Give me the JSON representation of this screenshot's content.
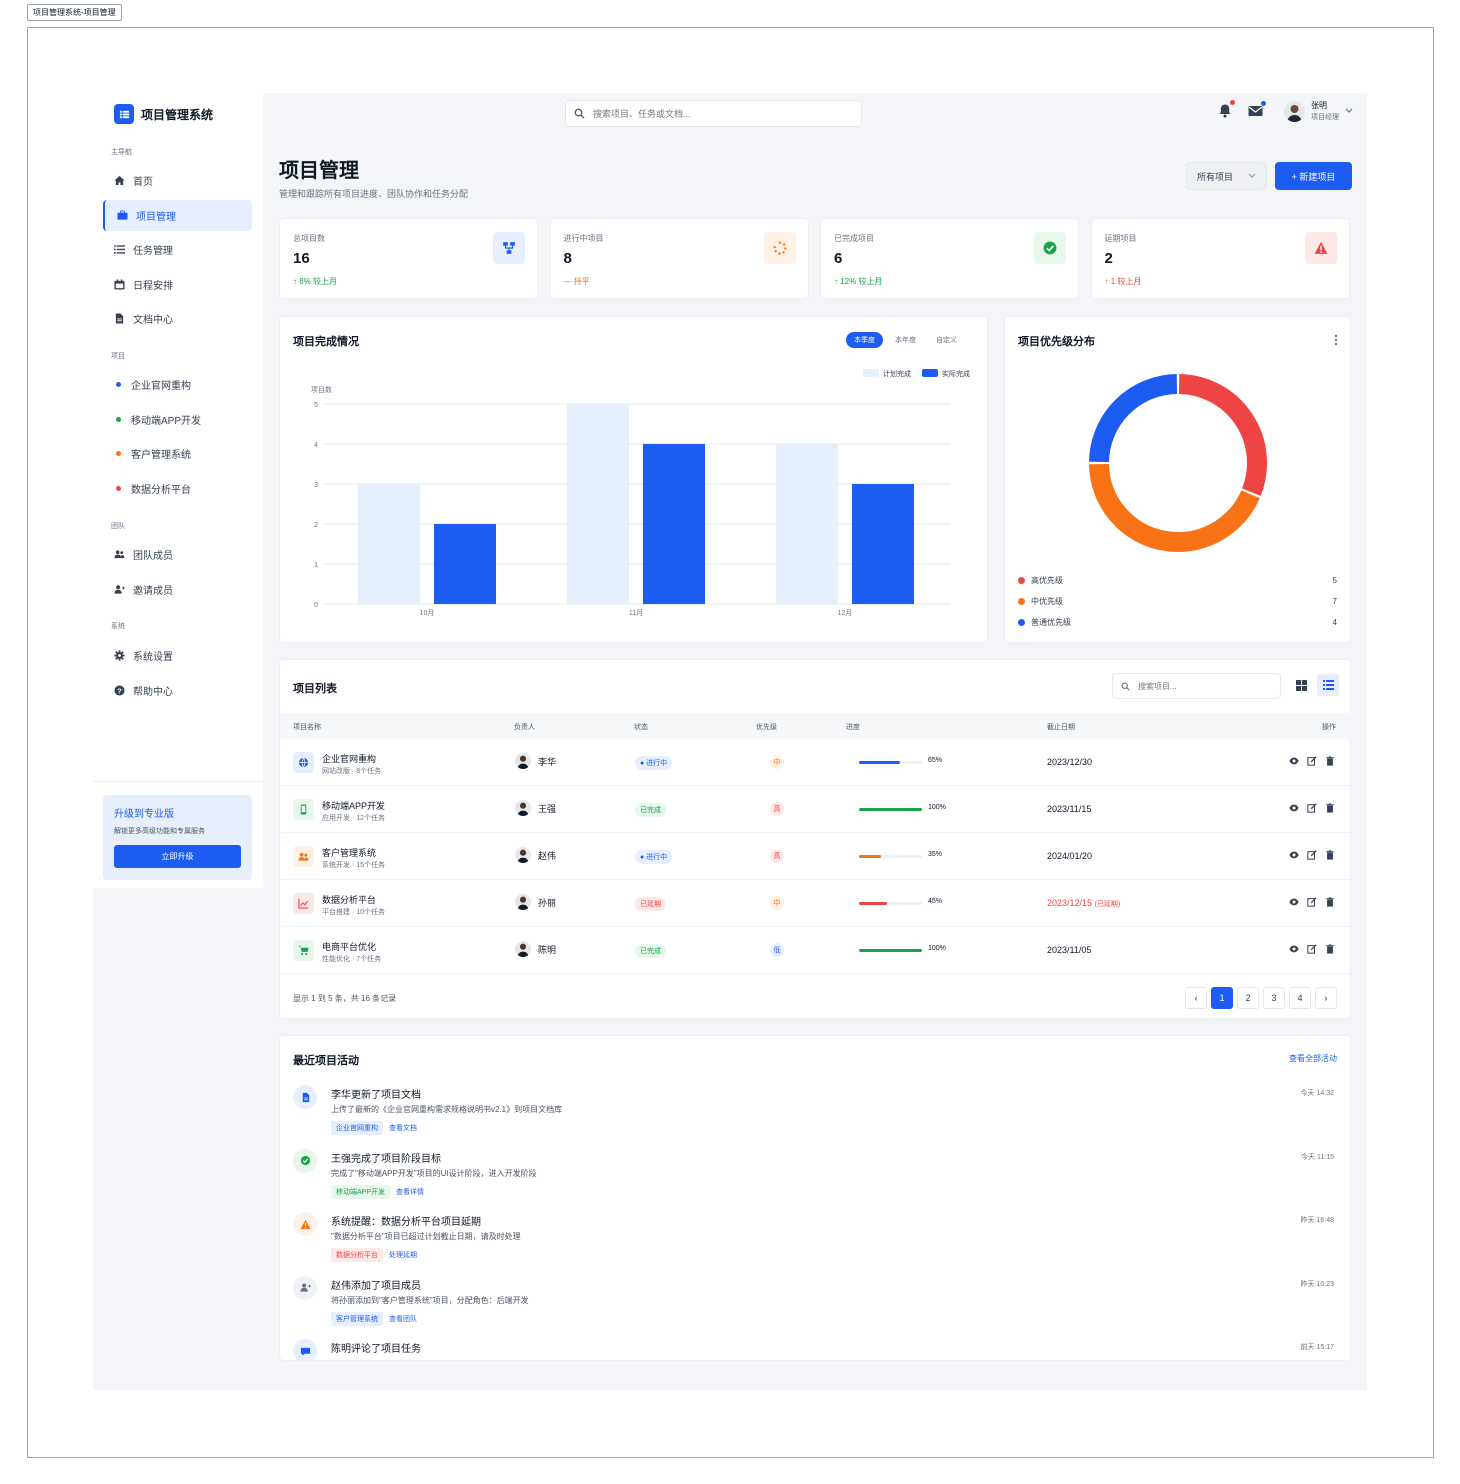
{
  "window_label": "项目管理系统-项目管理",
  "app": {
    "logo_text": "项目管理系统"
  },
  "search": {
    "placeholder": "搜索项目、任务或文档..."
  },
  "user": {
    "name": "张明",
    "role": "项目经理"
  },
  "sidebar": {
    "main_label": "主导航",
    "main_items": [
      {
        "label": "首页",
        "icon": "home-icon"
      },
      {
        "label": "项目管理",
        "icon": "briefcase-icon",
        "active": true
      },
      {
        "label": "任务管理",
        "icon": "list-icon"
      },
      {
        "label": "日程安排",
        "icon": "calendar-icon"
      },
      {
        "label": "文档中心",
        "icon": "file-icon"
      }
    ],
    "project_label": "项目",
    "projects": [
      {
        "label": "企业官网重构",
        "color": "#1d5cf0"
      },
      {
        "label": "移动端APP开发",
        "color": "#16a34a"
      },
      {
        "label": "客户管理系统",
        "color": "#f97316"
      },
      {
        "label": "数据分析平台",
        "color": "#ef4444"
      }
    ],
    "team_label": "团队",
    "team_items": [
      {
        "label": "团队成员",
        "icon": "users-icon"
      },
      {
        "label": "邀请成员",
        "icon": "user-plus-icon"
      }
    ],
    "system_label": "系统",
    "system_items": [
      {
        "label": "系统设置",
        "icon": "gear-icon"
      },
      {
        "label": "帮助中心",
        "icon": "help-icon"
      }
    ],
    "upgrade": {
      "title": "升级到专业版",
      "desc": "解锁更多高级功能和专属服务",
      "button": "立即升级"
    }
  },
  "page": {
    "title": "项目管理",
    "subtitle": "管理和跟踪所有项目进度、团队协作和任务分配",
    "filter_label": "所有项目",
    "new_button": "+ 新建项目"
  },
  "stats": [
    {
      "label": "总项目数",
      "value": "16",
      "change": "↑ 8% 较上月",
      "color": "#16a34a",
      "icon_bg": "#e6eeff",
      "icon_color": "#1d5cf0"
    },
    {
      "label": "进行中项目",
      "value": "8",
      "change": "— 持平",
      "color": "#f97316",
      "icon_bg": "#fff1e6",
      "icon_color": "#f97316"
    },
    {
      "label": "已完成项目",
      "value": "6",
      "change": "↑ 12% 较上月",
      "color": "#16a34a",
      "icon_bg": "#e7f7ec",
      "icon_color": "#16a34a"
    },
    {
      "label": "延期项目",
      "value": "2",
      "change": "↑ 1 较上月",
      "color": "#ef4444",
      "icon_bg": "#fde8e8",
      "icon_color": "#ef4444"
    }
  ],
  "completion": {
    "title": "项目完成情况",
    "tabs": [
      "本季度",
      "本年度",
      "自定义"
    ]
  },
  "chart_data": [
    {
      "type": "bar",
      "title": "项目完成情况",
      "ylabel": "项目数",
      "categories": [
        "10月",
        "11月",
        "12月"
      ],
      "ylim": [
        0,
        5
      ],
      "yticks": [
        0,
        1,
        2,
        3,
        4,
        5
      ],
      "legend_position": "top-right",
      "series": [
        {
          "name": "计划完成",
          "values": [
            3,
            5,
            4
          ],
          "color": "#e6effc"
        },
        {
          "name": "实际完成",
          "values": [
            2,
            4,
            3
          ],
          "color": "#1d5cf0"
        }
      ]
    },
    {
      "type": "pie",
      "title": "项目优先级分布",
      "labels": [
        "高优先级",
        "中优先级",
        "普通优先级"
      ],
      "values": [
        5,
        7,
        4
      ],
      "colors": [
        "#ef4444",
        "#f97316",
        "#1d5cf0"
      ]
    }
  ],
  "priority": {
    "title": "项目优先级分布",
    "items": [
      {
        "label": "高优先级",
        "value": "5",
        "color": "#ef4444"
      },
      {
        "label": "中优先级",
        "value": "7",
        "color": "#f97316"
      },
      {
        "label": "普通优先级",
        "value": "4",
        "color": "#1d5cf0"
      }
    ]
  },
  "project_list": {
    "title": "项目列表",
    "search_placeholder": "搜索项目...",
    "columns": [
      "项目名称",
      "负责人",
      "状态",
      "优先级",
      "进度",
      "截止日期",
      "操作"
    ],
    "rows": [
      {
        "name": "企业官网重构",
        "sub": "网站改版 · 8个任务",
        "owner": "李华",
        "status": "● 进行中",
        "status_fg": "#1d5cf0",
        "status_bg": "#e6eeff",
        "priority": "中",
        "prio_fg": "#f97316",
        "prio_bg": "#fff1e6",
        "progress": 65,
        "pct": "65%",
        "bar_color": "#1d5cf0",
        "due": "2023/12/30",
        "due_note": "",
        "icon": "globe-icon",
        "icon_bg": "#e6eeff",
        "icon_color": "#1d5cf0"
      },
      {
        "name": "移动端APP开发",
        "sub": "应用开发 · 12个任务",
        "owner": "王强",
        "status": "已完成",
        "status_fg": "#16a34a",
        "status_bg": "#e7f7ec",
        "priority": "高",
        "prio_fg": "#ef4444",
        "prio_bg": "#fde8e8",
        "progress": 100,
        "pct": "100%",
        "bar_color": "#16a34a",
        "due": "2023/11/15",
        "due_note": "",
        "icon": "mobile-icon",
        "icon_bg": "#e7f7ec",
        "icon_color": "#16a34a"
      },
      {
        "name": "客户管理系统",
        "sub": "系统开发 · 15个任务",
        "owner": "赵伟",
        "status": "● 进行中",
        "status_fg": "#1d5cf0",
        "status_bg": "#e6eeff",
        "priority": "高",
        "prio_fg": "#ef4444",
        "prio_bg": "#fde8e8",
        "progress": 35,
        "pct": "35%",
        "bar_color": "#f97316",
        "due": "2024/01/20",
        "due_note": "",
        "icon": "users-icon",
        "icon_bg": "#fff1e6",
        "icon_color": "#f97316"
      },
      {
        "name": "数据分析平台",
        "sub": "平台搭建 · 10个任务",
        "owner": "孙丽",
        "status": "已延期",
        "status_fg": "#ef4444",
        "status_bg": "#fde8e8",
        "priority": "中",
        "prio_fg": "#f97316",
        "prio_bg": "#fff1e6",
        "progress": 45,
        "pct": "45%",
        "bar_color": "#ef4444",
        "due": "2023/12/15",
        "due_note": "(已延期)",
        "icon": "chart-line-icon",
        "icon_bg": "#fde8e8",
        "icon_color": "#ef4444"
      },
      {
        "name": "电商平台优化",
        "sub": "性能优化 · 7个任务",
        "owner": "陈明",
        "status": "已完成",
        "status_fg": "#16a34a",
        "status_bg": "#e7f7ec",
        "priority": "低",
        "prio_fg": "#1d5cf0",
        "prio_bg": "#e6eeff",
        "progress": 100,
        "pct": "100%",
        "bar_color": "#16a34a",
        "due": "2023/11/05",
        "due_note": "",
        "icon": "cart-icon",
        "icon_bg": "#e7f7ec",
        "icon_color": "#16a34a"
      }
    ],
    "summary": "显示 1 到 5 条，共 16 条记录",
    "pages": [
      "1",
      "2",
      "3",
      "4"
    ]
  },
  "activity": {
    "title": "最近项目活动",
    "view_all": "查看全部活动",
    "items": [
      {
        "title": "李华更新了项目文档",
        "desc": "上传了最新的《企业官网重构需求规格说明书v2.1》到项目文档库",
        "tag": "企业官网重构",
        "tag_fg": "#1d5cf0",
        "tag_bg": "#e6eeff",
        "link": "查看文档",
        "time": "今天 14:32",
        "icon": "document-icon",
        "icon_bg": "#e6eeff",
        "icon_color": "#1d5cf0"
      },
      {
        "title": "王强完成了项目阶段目标",
        "desc": "完成了\"移动端APP开发\"项目的UI设计阶段，进入开发阶段",
        "tag": "移动端APP开发",
        "tag_fg": "#16a34a",
        "tag_bg": "#e7f7ec",
        "link": "查看详情",
        "time": "今天 11:15",
        "icon": "check-circle-icon",
        "icon_bg": "#e7f7ec",
        "icon_color": "#16a34a"
      },
      {
        "title": "系统提醒：数据分析平台项目延期",
        "desc": "\"数据分析平台\"项目已超过计划截止日期，请及时处理",
        "tag": "数据分析平台",
        "tag_fg": "#ef4444",
        "tag_bg": "#fde8e8",
        "link": "处理延期",
        "time": "昨天 16:48",
        "icon": "warning-icon",
        "icon_bg": "#fff1e6",
        "icon_color": "#f97316"
      },
      {
        "title": "赵伟添加了项目成员",
        "desc": "将孙丽添加到\"客户管理系统\"项目，分配角色：后端开发",
        "tag": "客户管理系统",
        "tag_fg": "#1d5cf0",
        "tag_bg": "#e6eeff",
        "link": "查看团队",
        "time": "昨天 10:23",
        "icon": "user-plus-icon",
        "icon_bg": "#f1f2f5",
        "icon_color": "#6b7280"
      },
      {
        "title": "陈明评论了项目任务",
        "desc": "",
        "tag": "",
        "tag_fg": "#1d5cf0",
        "tag_bg": "#e6eeff",
        "link": "",
        "time": "前天 15:17",
        "icon": "comment-icon",
        "icon_bg": "#e6eeff",
        "icon_color": "#1d5cf0"
      }
    ]
  }
}
